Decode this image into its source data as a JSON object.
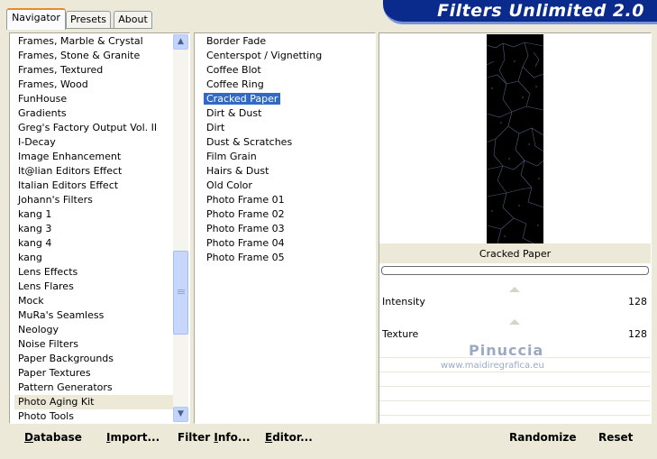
{
  "tabs": [
    {
      "label": "Navigator",
      "active": true
    },
    {
      "label": "Presets",
      "active": false
    },
    {
      "label": "About",
      "active": false
    }
  ],
  "title": "Filters Unlimited 2.0",
  "categories": [
    "Frames, Marble & Crystal",
    "Frames, Stone & Granite",
    "Frames, Textured",
    "Frames, Wood",
    "FunHouse",
    "Gradients",
    "Greg's Factory Output Vol. II",
    "I-Decay",
    "Image Enhancement",
    "It@lian Editors Effect",
    "Italian Editors Effect",
    "Johann's Filters",
    "kang 1",
    "kang 3",
    "kang 4",
    "kang",
    "Lens Effects",
    "Lens Flares",
    "Mock",
    "MuRa's Seamless",
    "Neology",
    "Noise Filters",
    "Paper Backgrounds",
    "Paper Textures",
    "Pattern Generators",
    "Photo Aging Kit",
    "Photo Tools"
  ],
  "selected_category": "Photo Aging Kit",
  "filters": [
    "Border Fade",
    "Centerspot / Vignetting",
    "Coffee Blot",
    "Coffee Ring",
    "Cracked Paper",
    "Dirt & Dust",
    "Dirt",
    "Dust & Scratches",
    "Film Grain",
    "Hairs & Dust",
    "Old Color",
    "Photo Frame 01",
    "Photo Frame 02",
    "Photo Frame 03",
    "Photo Frame 04",
    "Photo Frame 05"
  ],
  "selected_filter": "Cracked Paper",
  "preview_label": "Cracked Paper",
  "params": [
    {
      "name": "Intensity",
      "value": "128"
    },
    {
      "name": "Texture",
      "value": "128"
    }
  ],
  "watermark": {
    "name": "Pinuccia",
    "url": "www.maidiregrafica.eu"
  },
  "buttons": {
    "database": {
      "first": "D",
      "rest": "atabase"
    },
    "import": {
      "first": "I",
      "rest": "mport..."
    },
    "filter_info": {
      "pre": "Filter ",
      "first": "I",
      "rest": "nfo..."
    },
    "editor": {
      "first": "E",
      "rest": "ditor..."
    },
    "randomize": "Randomize",
    "reset": "Reset"
  },
  "colors": {
    "accent_blue": "#0a2a8c",
    "selection": "#316ac5",
    "tab_highlight": "#e68b2c"
  },
  "icons": {
    "scroll_up": "chevron-up-icon",
    "scroll_down": "chevron-down-icon"
  }
}
